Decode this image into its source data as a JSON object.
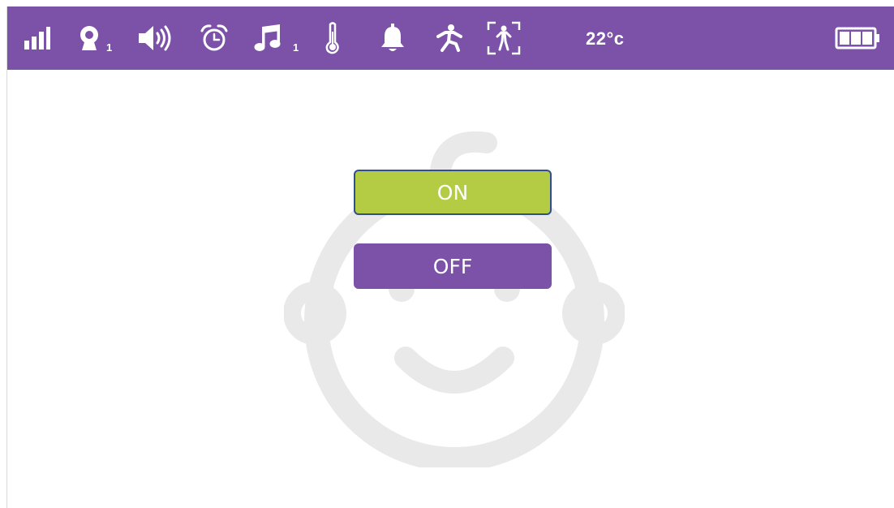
{
  "colors": {
    "status_bar": "#7b52a8",
    "on_button": "#b3cc43",
    "on_button_border": "#2f4f8f",
    "off_button": "#7b52a8",
    "baby_watermark": "#e9e9e9"
  },
  "status_bar": {
    "icons": [
      {
        "name": "signal-strength-icon"
      },
      {
        "name": "camera-icon",
        "badge": "1"
      },
      {
        "name": "speaker-volume-icon"
      },
      {
        "name": "alarm-clock-icon"
      },
      {
        "name": "music-note-icon",
        "badge": "1"
      },
      {
        "name": "thermometer-icon"
      },
      {
        "name": "bell-icon"
      },
      {
        "name": "motion-detection-icon"
      },
      {
        "name": "person-frame-icon"
      },
      {
        "name": "battery-icon"
      }
    ],
    "temperature": "22°c"
  },
  "main": {
    "background_icon": "baby-face-icon",
    "on_label": "ON",
    "off_label": "OFF"
  }
}
